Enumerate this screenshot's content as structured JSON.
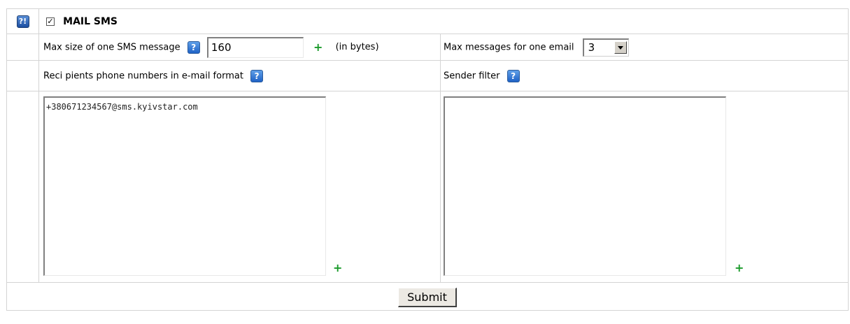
{
  "section": {
    "help_icon": "help-icon",
    "checkbox_mark": "✓",
    "title": "MAIL SMS"
  },
  "max_size": {
    "label": "Max size of one SMS message",
    "value": "160",
    "unit": "(in bytes)",
    "plus": "+"
  },
  "max_messages": {
    "label": "Max messages for one email",
    "value": "3"
  },
  "recipients": {
    "label": "Reci pients phone numbers in e-mail format",
    "value": "+380671234567@sms.kyivstar.com",
    "plus": "+"
  },
  "sender_filter": {
    "label": "Sender filter",
    "value": "",
    "plus": "+"
  },
  "submit": {
    "label": "Submit"
  },
  "colors": {
    "help_blue": "#2a6fd0",
    "plus_green": "#1a9a2a",
    "border": "#d4d4d4"
  }
}
